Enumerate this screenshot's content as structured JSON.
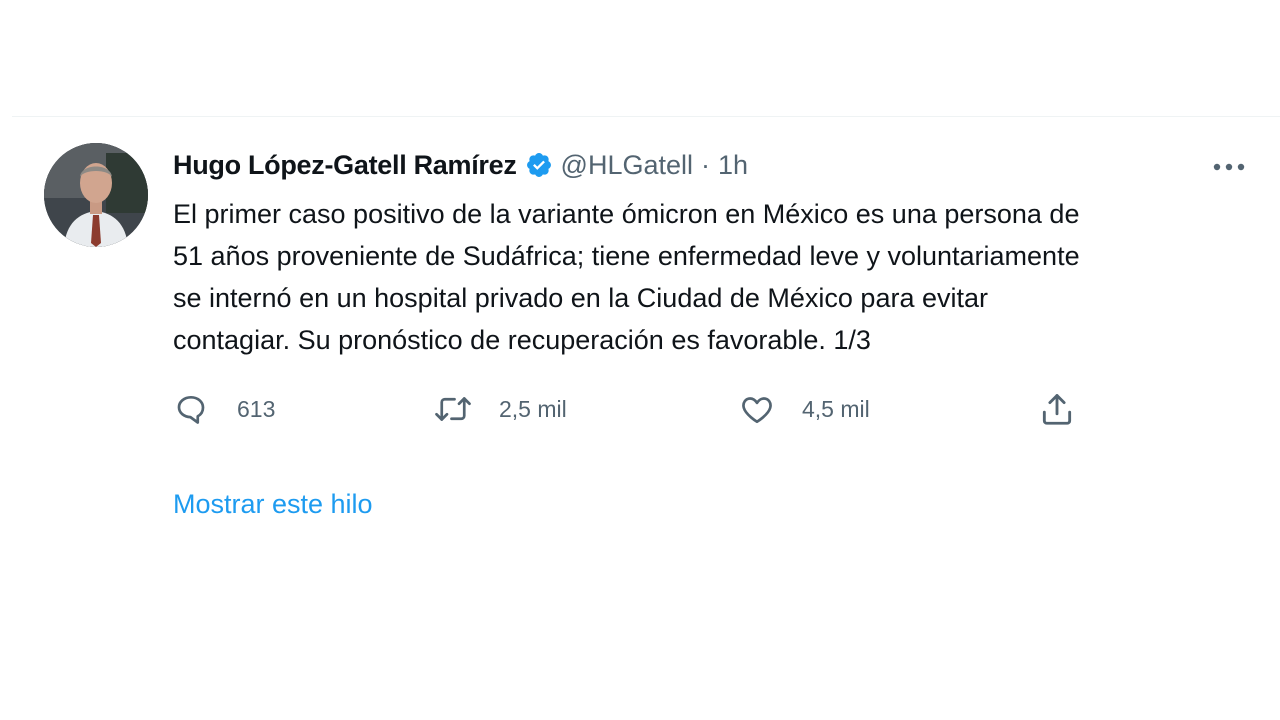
{
  "tweet": {
    "author": {
      "display_name": "Hugo López-Gatell Ramírez",
      "handle": "@HLGatell",
      "verified": true
    },
    "separator": "·",
    "time": "1h",
    "text": "El primer caso positivo de la variante ómicron en México es una persona de\n51 años proveniente de Sudáfrica; tiene enfermedad leve y voluntariamente\nse internó en un hospital privado en la Ciudad de México para evitar\ncontagiar. Su pronóstico de recuperación es favorable. 1/3",
    "actions": {
      "replies": "613",
      "retweets": "2,5 mil",
      "likes": "4,5 mil"
    },
    "show_thread": "Mostrar este hilo"
  },
  "icons": {
    "verified": "verified-badge-icon",
    "more": "more-options-icon",
    "reply": "reply-icon",
    "retweet": "retweet-icon",
    "like": "heart-icon",
    "share": "share-icon"
  },
  "colors": {
    "text": "#0f1419",
    "secondary": "#536471",
    "accent": "#1d9bf0",
    "divider": "#eff3f4"
  }
}
